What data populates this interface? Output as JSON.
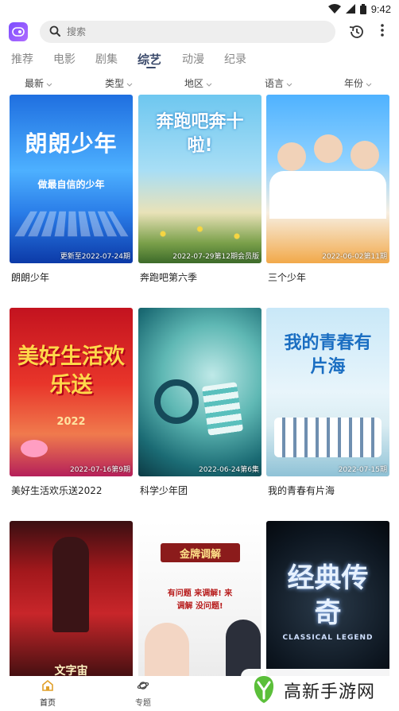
{
  "status_bar": {
    "time": "9:42"
  },
  "search": {
    "placeholder": "搜索"
  },
  "tabs": [
    "推荐",
    "电影",
    "剧集",
    "综艺",
    "动漫",
    "纪录"
  ],
  "active_tab": "综艺",
  "filters": [
    "最新",
    "类型",
    "地区",
    "语言",
    "年份"
  ],
  "cards": [
    {
      "title": "朗朗少年",
      "poster_text": "朗朗少年",
      "poster_sub": "做最自信的少年",
      "date": "更新至2022-07-24期"
    },
    {
      "title": "奔跑吧第六季",
      "poster_text": "奔跑吧奔十啦!",
      "poster_sub": "",
      "date": "2022-07-29第12期会员版"
    },
    {
      "title": "三个少年",
      "poster_text": "",
      "poster_sub": "",
      "date": "2022-06-02第11期"
    },
    {
      "title": "美好生活欢乐送2022",
      "poster_text": "美好生活欢乐送",
      "poster_sub": "2022",
      "date": "2022-07-16第9期"
    },
    {
      "title": "科学少年团",
      "poster_text": "",
      "poster_sub": "",
      "date": "2022-06-24第6集"
    },
    {
      "title": "我的青春有片海",
      "poster_text": "我的青春有片海",
      "poster_sub": "",
      "date": "2022-07-15期"
    },
    {
      "title": "",
      "poster_text": "文字宙",
      "poster_sub": "",
      "date": ""
    },
    {
      "title": "",
      "poster_text": "金牌调解",
      "poster_sub": "有问题 来调解! 来调解 没问题!",
      "date": ""
    },
    {
      "title": "",
      "poster_text": "经典传奇",
      "poster_sub": "CLASSICAL LEGEND",
      "date": ""
    }
  ],
  "bottom_nav": [
    {
      "label": "首页",
      "icon": "home-icon"
    },
    {
      "label": "专题",
      "icon": "planet-icon"
    }
  ],
  "watermark": {
    "text": "高新手游网"
  },
  "colors": {
    "accent": "#3b4a6b",
    "logo": "#7b4dff"
  }
}
